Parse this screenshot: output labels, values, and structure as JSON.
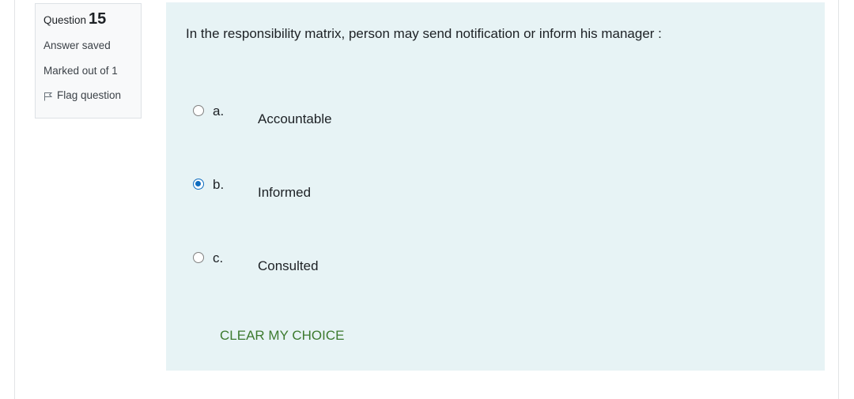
{
  "info": {
    "question_label": "Question",
    "question_number": "15",
    "status": "Answer saved",
    "marks": "Marked out of 1",
    "flag_label": "Flag question"
  },
  "question": {
    "text": "In the responsibility matrix, person may send notification or inform his manager :",
    "options": [
      {
        "letter": "a.",
        "text": "Accountable",
        "selected": false
      },
      {
        "letter": "b.",
        "text": "Informed",
        "selected": true
      },
      {
        "letter": "c.",
        "text": "Consulted",
        "selected": false
      }
    ],
    "clear_label": "CLEAR MY CHOICE"
  },
  "colors": {
    "content_bg": "#e7f3f5",
    "info_bg": "#f8f9fa",
    "radio_selected": "#0f6cbf",
    "clear_link": "#3c7a2e"
  },
  "icons": {
    "flag": "flag-icon"
  }
}
